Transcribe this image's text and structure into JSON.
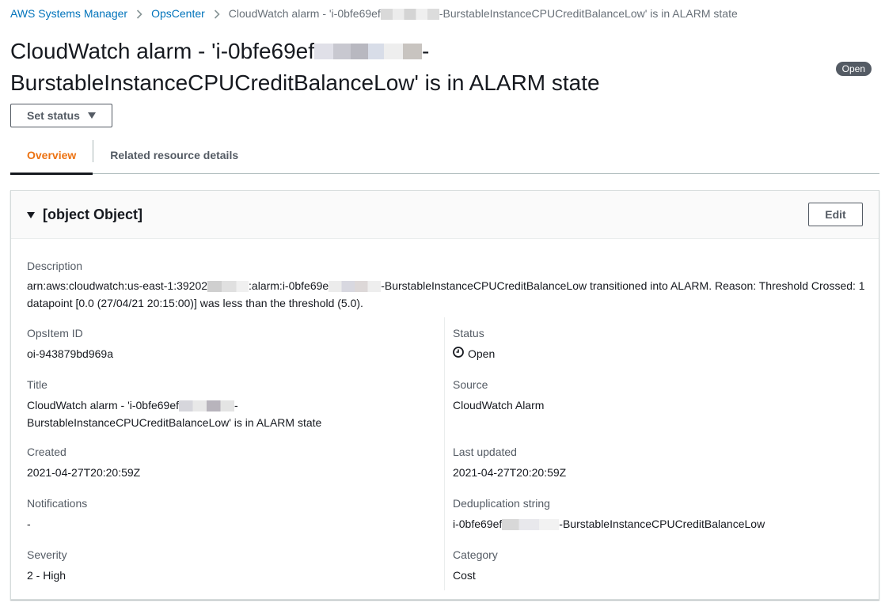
{
  "breadcrumb": {
    "items": [
      "AWS Systems Manager",
      "OpsCenter"
    ],
    "current_prefix": "CloudWatch alarm - 'i-0bfe69ef",
    "current_suffix": "-BurstableInstanceCPUCreditBalanceLow' is in ALARM state"
  },
  "page": {
    "title_line1_prefix": "CloudWatch alarm - 'i-0bfe69ef",
    "title_line1_suffix": "-",
    "title_line2": "BurstableInstanceCPUCreditBalanceLow' is in ALARM state",
    "status_badge": "Open",
    "set_status_label": "Set status"
  },
  "tabs": [
    {
      "label": "Overview",
      "active": true
    },
    {
      "label": "Related resource details",
      "active": false
    }
  ],
  "panel": {
    "title": {
      "label": "Title",
      "value_prefix": "CloudWatch alarm - 'i-0bfe69ef",
      "value_suffix": "-",
      "value_line2": "BurstableInstanceCPUCreditBalanceLow' is in ALARM state"
    },
    "edit_label": "Edit",
    "description": {
      "label": "Description",
      "part1": "arn:aws:cloudwatch:us-east-1:39202",
      "part2": ":alarm:i-0bfe69e",
      "part3": "-BurstableInstanceCPUCreditBalanceLow transitioned into ALARM. Reason: Threshold Crossed: 1 datapoint [0.0 (27/04/21 20:15:00)] was less than the threshold (5.0)."
    },
    "opsitem_id": {
      "label": "OpsItem ID",
      "value": "oi-943879bd969a"
    },
    "status": {
      "label": "Status",
      "value": "Open"
    },
    "source": {
      "label": "Source",
      "value": "CloudWatch Alarm"
    },
    "created": {
      "label": "Created",
      "value": "2021-04-27T20:20:59Z"
    },
    "last_updated": {
      "label": "Last updated",
      "value": "2021-04-27T20:20:59Z"
    },
    "notifications": {
      "label": "Notifications",
      "value": "-"
    },
    "dedup": {
      "label": "Deduplication string",
      "value_prefix": "i-0bfe69ef",
      "value_suffix": "-BurstableInstanceCPUCreditBalanceLow"
    },
    "severity": {
      "label": "Severity",
      "value": "2 - High"
    },
    "category": {
      "label": "Category",
      "value": "Cost"
    }
  },
  "colors": {
    "link": "#0073bb",
    "active_tab": "#ec7211",
    "badge_bg": "#545b64",
    "text": "#16191f",
    "label": "#545b64"
  },
  "icons": [
    "chevron-right-icon",
    "caret-down-icon",
    "clock-icon"
  ]
}
